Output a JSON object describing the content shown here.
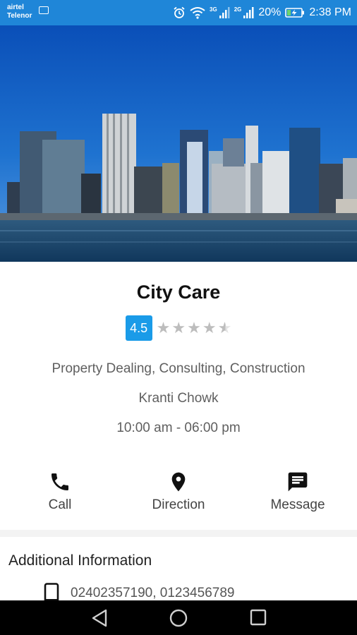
{
  "status_bar": {
    "carrier_1": "airtel",
    "carrier_2": "Telenor",
    "net_1": "3G",
    "net_2": "2G",
    "battery": "20%",
    "time": "2:38 PM"
  },
  "hero": {
    "image": "city skyline across water"
  },
  "business": {
    "name": "City Care",
    "rating": "4.5",
    "stars": 4.5,
    "category": "Property Dealing, Consulting, Construction",
    "address": "Kranti Chowk",
    "hours": "10:00 am - 06:00 pm"
  },
  "actions": [
    {
      "label": "Call",
      "icon": "phone-icon"
    },
    {
      "label": "Direction",
      "icon": "location-pin-icon"
    },
    {
      "label": "Message",
      "icon": "message-icon"
    }
  ],
  "additional": {
    "title": "Additional Information",
    "phones": "02402357190, 0123456789",
    "phone_icon": "mobile-phone-icon"
  },
  "colors": {
    "status_bar": "#1f86d8",
    "rating_badge": "#1a9be8",
    "nav_bar": "#000000"
  }
}
